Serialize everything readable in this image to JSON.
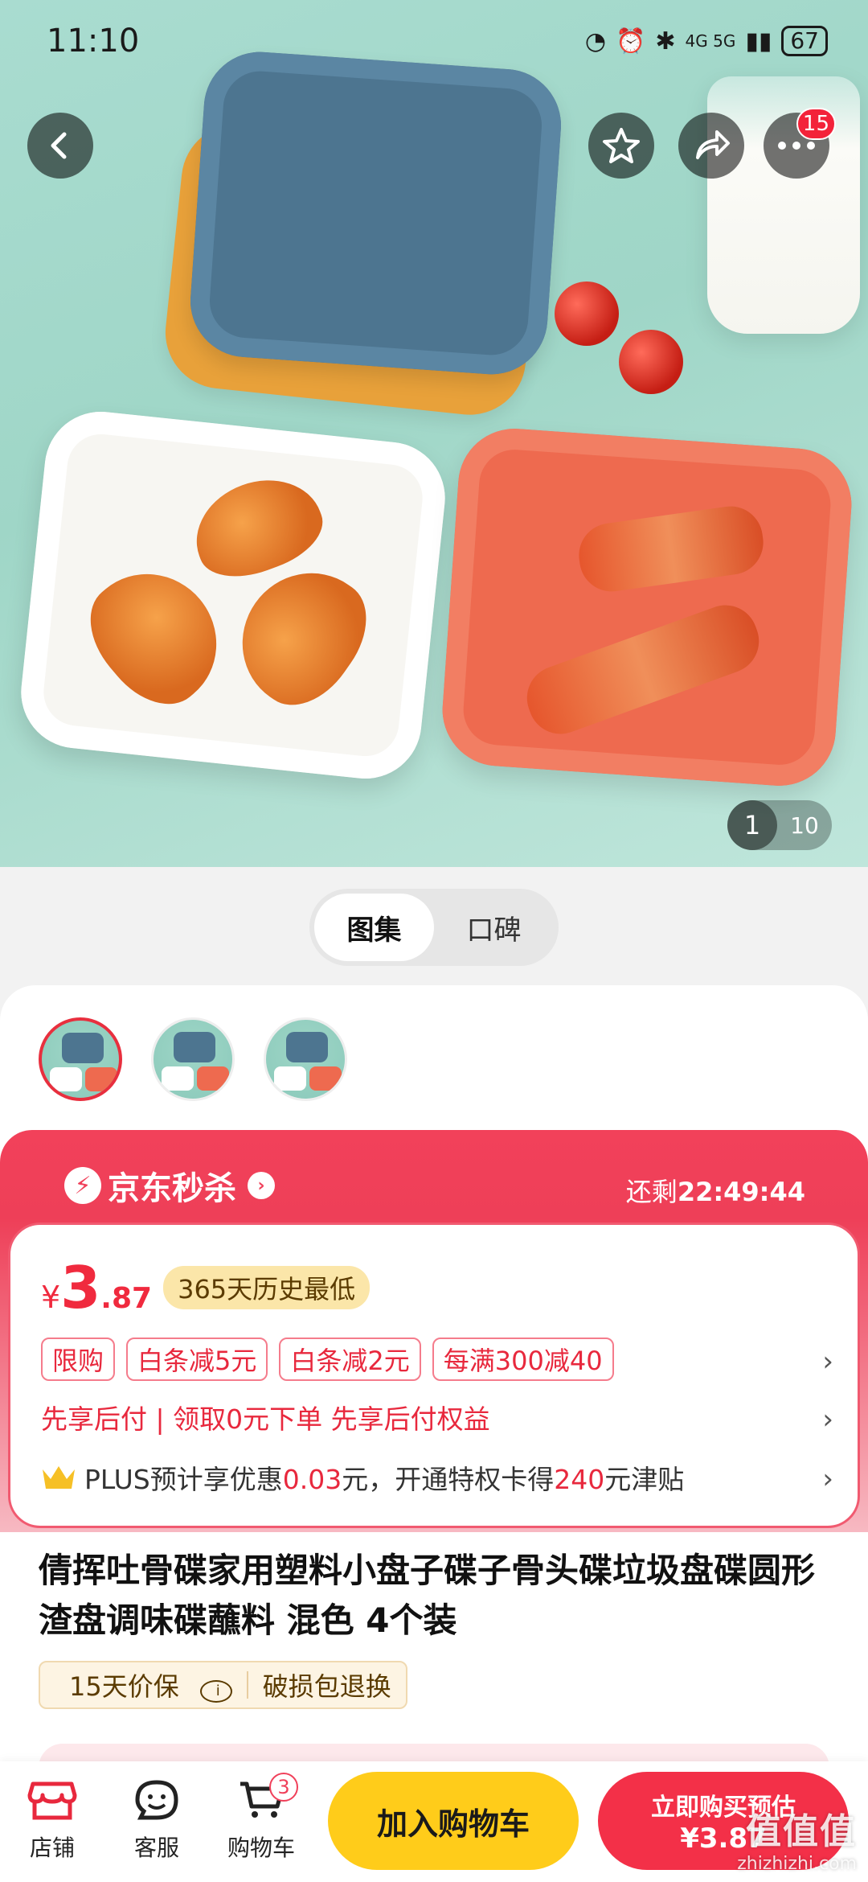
{
  "status_bar": {
    "time": "11:10",
    "network": "4G 5G",
    "battery": "67"
  },
  "hero": {
    "image_index": "1",
    "image_total": "10",
    "more_badge": "15"
  },
  "media_tabs": [
    {
      "label": "图集",
      "active": true
    },
    {
      "label": "口碑",
      "active": false
    }
  ],
  "flash_sale": {
    "title": "京东秒杀",
    "countdown_label": "还剩",
    "countdown": "22:49:44"
  },
  "price": {
    "currency": "¥",
    "integer": "3",
    "decimal": ".87",
    "tag": "365天历史最低"
  },
  "promos": [
    "限购",
    "白条减5元",
    "白条减2元",
    "每满300减40"
  ],
  "payment": {
    "text1": "先享后付",
    "text2": "领取0元下单 先享后付权益"
  },
  "plus": {
    "prefix": "PLUS预计享优惠",
    "amount1": "0.03",
    "mid": "元，开通特权卡得",
    "amount2": "240",
    "suffix": "元津贴"
  },
  "product_title": "倩挥吐骨碟家用塑料小盘子碟子骨头碟垃圾盘碟圆形渣盘调味碟蘸料 混色 4个装",
  "services": [
    "15天价保",
    "破损包退换"
  ],
  "bottom_bar": {
    "store_label": "店铺",
    "service_label": "客服",
    "cart_label": "购物车",
    "cart_count": "3",
    "add_cart": "加入购物车",
    "buy_now_line1": "立即购买预估",
    "buy_now_line2": "¥3.87"
  },
  "watermark": {
    "big": "值值值",
    "small": "zhizhizhi.com"
  }
}
